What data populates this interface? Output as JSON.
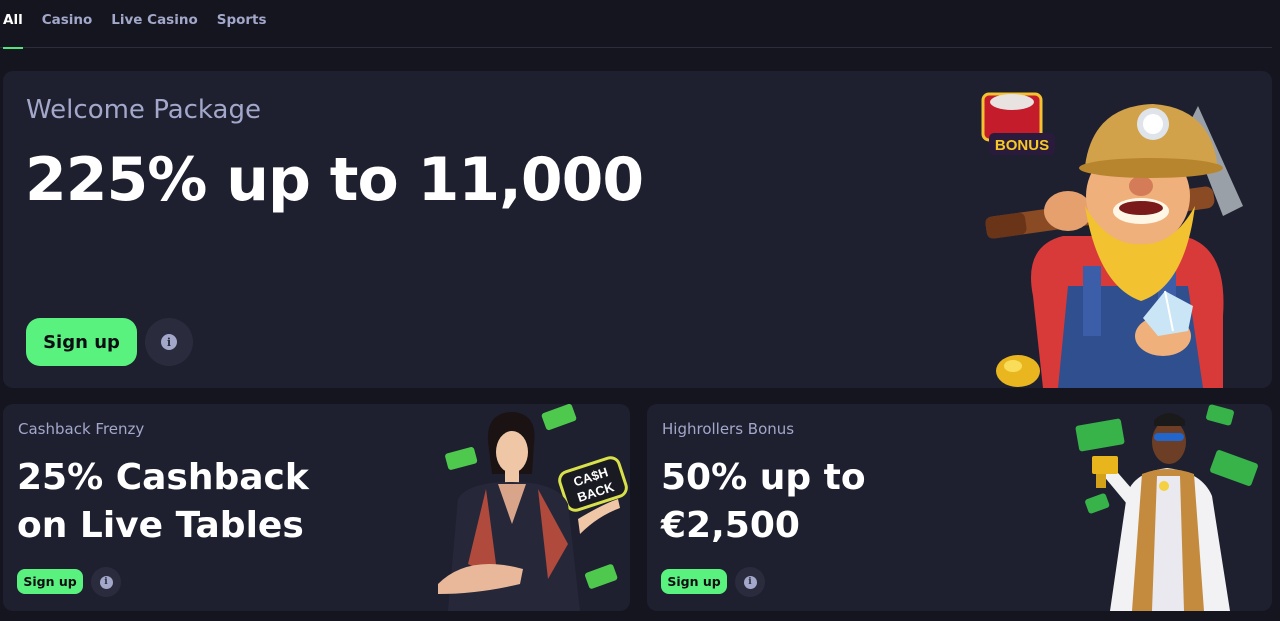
{
  "tabs": [
    {
      "label": "All",
      "active": true
    },
    {
      "label": "Casino",
      "active": false
    },
    {
      "label": "Live Casino",
      "active": false
    },
    {
      "label": "Sports",
      "active": false
    }
  ],
  "welcome": {
    "label": "Welcome Package",
    "headline": "225% up to 11,000",
    "signup_label": "Sign up",
    "art_text": "BONUS"
  },
  "cashback": {
    "label": "Cashback Frenzy",
    "headline_line1": "25% Cashback",
    "headline_line2": "on Live Tables",
    "signup_label": "Sign up",
    "art_text_1": "CA$H",
    "art_text_2": "BACK"
  },
  "highrollers": {
    "label": "Highrollers Bonus",
    "headline_line1": "50% up to",
    "headline_line2": "€2,500",
    "signup_label": "Sign up"
  },
  "colors": {
    "background": "#14151f",
    "card": "#1e2030",
    "accent_green": "#5af27f",
    "muted_text": "#a3a7c9"
  },
  "icons": {
    "info": "info-icon"
  }
}
